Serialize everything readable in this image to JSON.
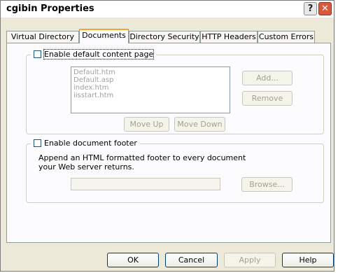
{
  "window": {
    "title": "cgibin Properties",
    "help_glyph": "?",
    "close_glyph": "✕"
  },
  "tabs": [
    {
      "label": "Virtual Directory"
    },
    {
      "label": "Documents"
    },
    {
      "label": "Directory Security"
    },
    {
      "label": "HTTP Headers"
    },
    {
      "label": "Custom Errors"
    }
  ],
  "default_content": {
    "checkbox_label": "Enable default content page",
    "checked": false,
    "documents": [
      "Default.htm",
      "Default.asp",
      "index.htm",
      "iisstart.htm"
    ],
    "add_label": "Add...",
    "remove_label": "Remove",
    "move_up_label": "Move Up",
    "move_down_label": "Move Down"
  },
  "footer": {
    "checkbox_label": "Enable document footer",
    "checked": false,
    "description": "Append an HTML formatted footer to every document your Web server returns.",
    "path_value": "",
    "browse_label": "Browse..."
  },
  "buttons": {
    "ok": "OK",
    "cancel": "Cancel",
    "apply": "Apply",
    "help": "Help"
  }
}
